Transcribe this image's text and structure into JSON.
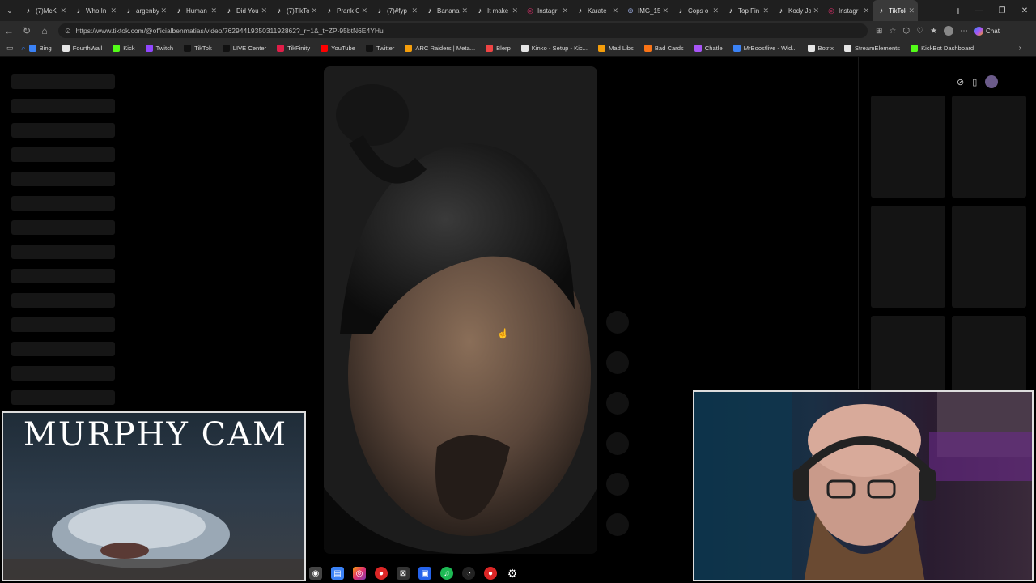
{
  "tabs": [
    {
      "title": "(7)McK",
      "icon": "tiktok-icon"
    },
    {
      "title": "Who In",
      "icon": "tiktok-icon"
    },
    {
      "title": "argenby",
      "icon": "tiktok-icon"
    },
    {
      "title": "Human",
      "icon": "tiktok-icon"
    },
    {
      "title": "Did You",
      "icon": "tiktok-icon"
    },
    {
      "title": "(7)TikTo",
      "icon": "tiktok-icon"
    },
    {
      "title": "Prank G",
      "icon": "tiktok-icon"
    },
    {
      "title": "(7)#fyp",
      "icon": "tiktok-icon"
    },
    {
      "title": "Banana",
      "icon": "tiktok-icon"
    },
    {
      "title": "It make",
      "icon": "tiktok-icon"
    },
    {
      "title": "Instagr",
      "icon": "instagram-icon"
    },
    {
      "title": "Karate",
      "icon": "tiktok-icon"
    },
    {
      "title": "IMG_15",
      "icon": "globe-icon"
    },
    {
      "title": "Cops o",
      "icon": "tiktok-icon"
    },
    {
      "title": "Top Fin",
      "icon": "tiktok-icon"
    },
    {
      "title": "Kody Ja",
      "icon": "tiktok-icon"
    },
    {
      "title": "Instagr",
      "icon": "instagram-icon"
    },
    {
      "title": "TikTok",
      "icon": "tiktok-icon",
      "active": true
    }
  ],
  "address": {
    "url": "https://www.tiktok.com/@officialbenmatias/video/7629441935031192862?_r=1&_t=ZP-95btN6E4YHu",
    "chat_label": "Chat"
  },
  "bookmarks": [
    {
      "label": "Bing",
      "color": "#3b82f6"
    },
    {
      "label": "FourthWall",
      "color": "#e5e5e5"
    },
    {
      "label": "Kick",
      "color": "#53fc18"
    },
    {
      "label": "Twitch",
      "color": "#9146ff"
    },
    {
      "label": "TikTok",
      "color": "#111111"
    },
    {
      "label": "LIVE Center",
      "color": "#111111"
    },
    {
      "label": "TikFinity",
      "color": "#e11d48"
    },
    {
      "label": "YouTube",
      "color": "#ff0000"
    },
    {
      "label": "Twitter",
      "color": "#111111"
    },
    {
      "label": "ARC Raiders | Meta...",
      "color": "#f59e0b"
    },
    {
      "label": "Blerp",
      "color": "#ef4444"
    },
    {
      "label": "Kinko - Setup - Kic...",
      "color": "#e5e5e5"
    },
    {
      "label": "Mad Libs",
      "color": "#f59e0b"
    },
    {
      "label": "Bad Cards",
      "color": "#f97316"
    },
    {
      "label": "Chatle",
      "color": "#a855f7"
    },
    {
      "label": "MrBoostlive - Wid...",
      "color": "#3b82f6"
    },
    {
      "label": "Botrix",
      "color": "#e5e5e5"
    },
    {
      "label": "StreamElements",
      "color": "#e5e5e5"
    },
    {
      "label": "KickBot Dashboard",
      "color": "#53fc18"
    }
  ],
  "overlay": {
    "murphy_label": "MURPHY CAM"
  },
  "colors": {
    "background": "#000000",
    "tabbar": "#1f1f1f",
    "toolbar": "#2b2b2b"
  }
}
